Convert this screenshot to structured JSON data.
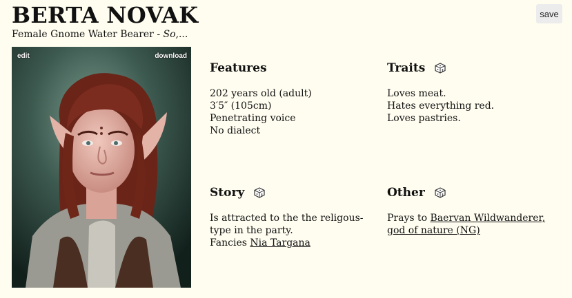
{
  "character": {
    "name": "BERTA NOVAK",
    "description": "Female Gnome Water Bearer -",
    "description_tag": "So,..."
  },
  "actions": {
    "save_label": "save",
    "edit_label": "edit",
    "download_label": "download"
  },
  "features": {
    "heading": "Features",
    "lines": [
      "202 years old (adult)",
      "3′5″ (105cm)",
      "Penetrating voice",
      "No dialect"
    ]
  },
  "traits": {
    "heading": "Traits",
    "lines": [
      "Loves meat.",
      "Hates everything red.",
      "Loves pastries."
    ]
  },
  "story": {
    "heading": "Story",
    "line1": "Is attracted to the the religous-type in the party.",
    "fancies_prefix": "Fancies",
    "fancies_link": "Nia Targana"
  },
  "other": {
    "heading": "Other",
    "prays_prefix": "Prays to",
    "deity_link": "Baervan Wildwanderer, god of nature (NG)"
  },
  "icons": {
    "randomize": "dice-icon"
  }
}
